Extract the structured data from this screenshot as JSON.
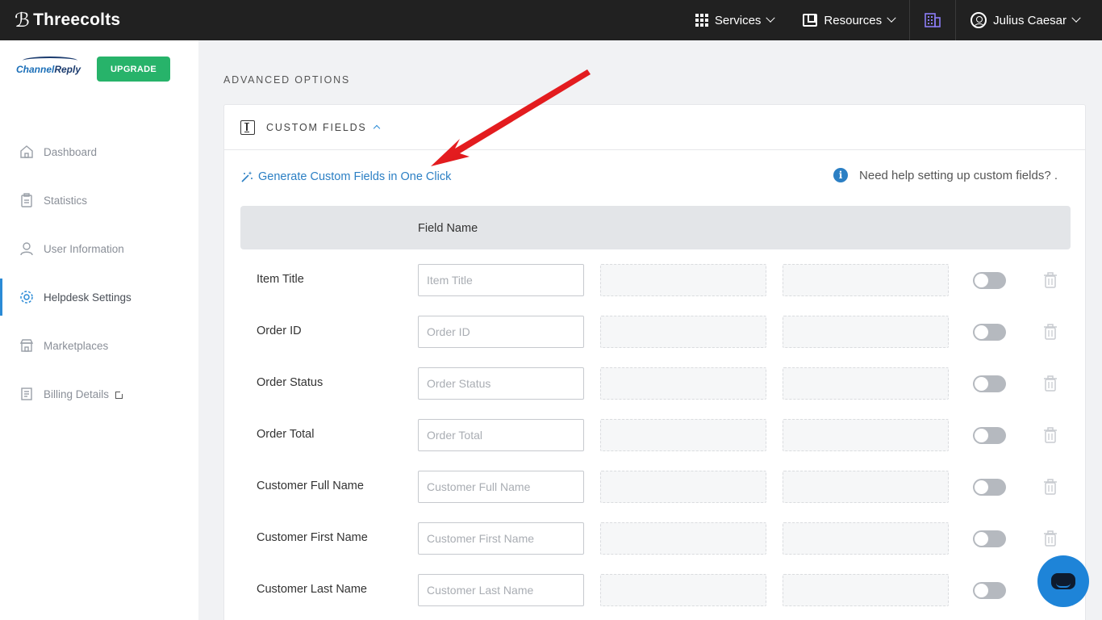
{
  "topbar": {
    "brand": "Threecolts",
    "services_label": "Services",
    "resources_label": "Resources",
    "user_name": "Julius Caesar"
  },
  "sidebar": {
    "brand_part1": "Channel",
    "brand_part2": "Reply",
    "upgrade_label": "UPGRADE",
    "items": [
      {
        "label": "Dashboard",
        "icon": "home-icon"
      },
      {
        "label": "Statistics",
        "icon": "clipboard-icon"
      },
      {
        "label": "User Information",
        "icon": "user-icon"
      },
      {
        "label": "Helpdesk Settings",
        "icon": "gear-icon",
        "active": true
      },
      {
        "label": "Marketplaces",
        "icon": "store-icon"
      },
      {
        "label": "Billing Details",
        "icon": "receipt-icon",
        "external": true
      }
    ]
  },
  "main": {
    "section_title": "ADVANCED OPTIONS",
    "card_title": "CUSTOM FIELDS",
    "generate_link": "Generate Custom Fields in One Click",
    "help_text": "Need help setting up custom fields? .",
    "table_header": "Field Name",
    "rows": [
      {
        "label": "Item Title",
        "placeholder": "Item Title"
      },
      {
        "label": "Order ID",
        "placeholder": "Order ID"
      },
      {
        "label": "Order Status",
        "placeholder": "Order Status"
      },
      {
        "label": "Order Total",
        "placeholder": "Order Total"
      },
      {
        "label": "Customer Full Name",
        "placeholder": "Customer Full Name"
      },
      {
        "label": "Customer First Name",
        "placeholder": "Customer First Name"
      },
      {
        "label": "Customer Last Name",
        "placeholder": "Customer Last Name"
      }
    ]
  },
  "colors": {
    "accent": "#2b7fc4",
    "upgrade": "#27b36a",
    "topbar": "#212121",
    "arrow": "#e0141b",
    "chat": "#1e84d8"
  }
}
